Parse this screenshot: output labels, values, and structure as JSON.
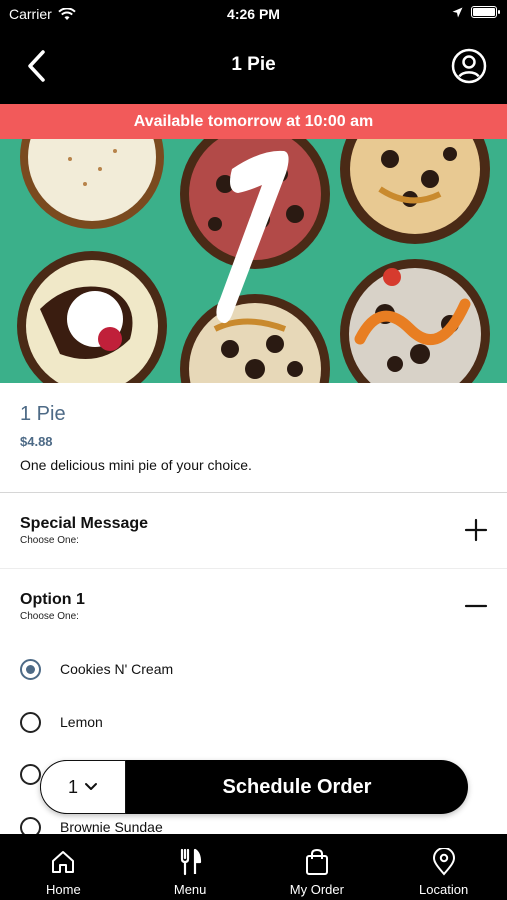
{
  "status_bar": {
    "carrier": "Carrier",
    "time": "4:26 PM"
  },
  "nav": {
    "title": "1 Pie"
  },
  "banner": {
    "text": "Available tomorrow at 10:00 am"
  },
  "hero": {
    "overlay_number": "1",
    "background_color": "#3bb08a"
  },
  "product": {
    "name": "1 Pie",
    "price": "$4.88",
    "description": "One delicious mini pie of your choice."
  },
  "sections": {
    "special_message": {
      "title": "Special Message",
      "subtitle": "Choose One:",
      "toggle_icon": "plus-icon"
    },
    "option1": {
      "title": "Option 1",
      "subtitle": "Choose One:",
      "toggle_icon": "minus-icon"
    }
  },
  "options": [
    {
      "label": "Cookies N' Cream",
      "selected": true
    },
    {
      "label": "Lemon",
      "selected": false
    },
    {
      "label": "",
      "selected": false
    },
    {
      "label": "Brownie Sundae",
      "selected": false
    }
  ],
  "order_bar": {
    "quantity": "1",
    "button_label": "Schedule Order"
  },
  "tabs": [
    {
      "label": "Home",
      "icon": "home-icon"
    },
    {
      "label": "Menu",
      "icon": "utensils-icon"
    },
    {
      "label": "My Order",
      "icon": "bag-icon"
    },
    {
      "label": "Location",
      "icon": "location-pin-icon"
    }
  ],
  "colors": {
    "accent_blue": "#4d6a86",
    "banner_red": "#f25a5a",
    "hero_green": "#3bb08a"
  }
}
